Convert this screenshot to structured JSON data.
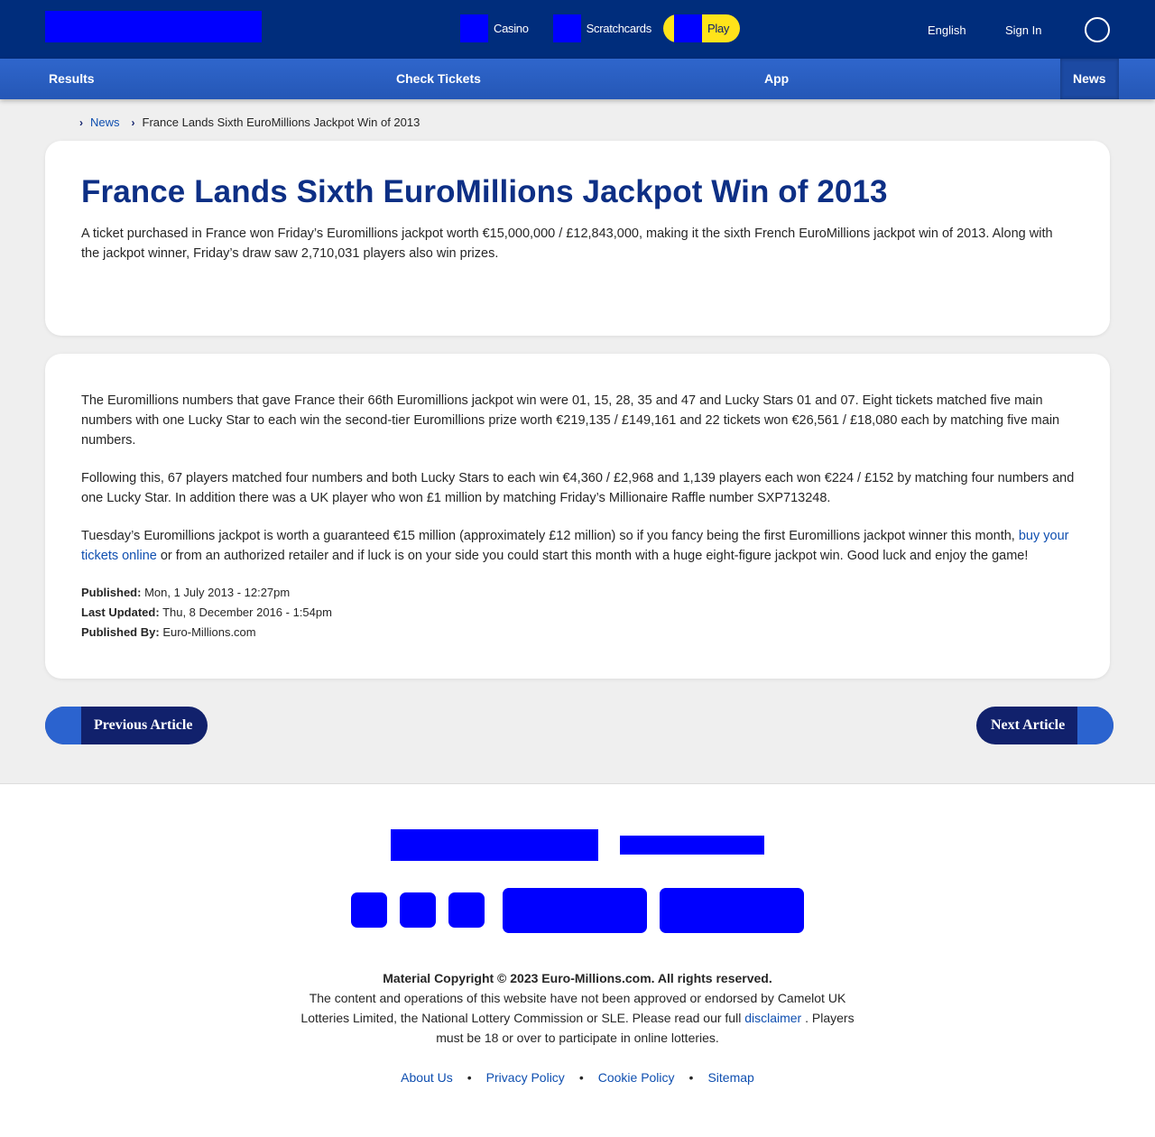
{
  "header": {
    "nav": [
      {
        "label": "Casino"
      },
      {
        "label": "Scratchcards"
      }
    ],
    "play_label": "Play",
    "language": "English",
    "sign_in": "Sign In"
  },
  "subnav": {
    "tabs": [
      "Results",
      "Check Tickets",
      "App",
      "News"
    ],
    "active": "News"
  },
  "breadcrumb": {
    "link": "News",
    "current": "France Lands Sixth EuroMillions Jackpot Win of 2013"
  },
  "article": {
    "title": "France Lands Sixth EuroMillions Jackpot Win of 2013",
    "intro": "A ticket purchased in France won Friday’s Euromillions jackpot worth €15,000,000 / £12,843,000, making it the sixth French EuroMillions jackpot win of 2013. Along with the jackpot winner, Friday’s draw saw 2,710,031 players also win prizes.",
    "p1": "The Euromillions numbers that gave France their 66th Euromillions jackpot win were 01, 15, 28, 35 and 47 and Lucky Stars 01 and 07. Eight tickets matched five main numbers with one Lucky Star to each win the second-tier Euromillions prize worth €219,135 / £149,161 and 22 tickets won €26,561 / £18,080 each by matching five main numbers.",
    "p2": "Following this, 67 players matched four numbers and both Lucky Stars to each win €4,360 / £2,968 and 1,139 players each won €224 / £152 by matching four numbers and one Lucky Star. In addition there was a UK player who won £1 million by matching Friday’s Millionaire Raffle number SXP713248.",
    "p3_before": "Tuesday’s Euromillions jackpot is worth a guaranteed €15 million (approximately £12 million) so if you fancy being the first Euromillions jackpot winner this month, ",
    "p3_link": "buy your tickets online",
    "p3_after": " or from an authorized retailer and if luck is on your side you could start this month with a huge eight-figure jackpot win. Good luck and enjoy the game!",
    "meta": {
      "published_label": "Published:",
      "published": "Mon, 1 July 2013 - 12:27pm",
      "updated_label": "Last Updated:",
      "updated": "Thu, 8 December 2016 - 1:54pm",
      "by_label": "Published By:",
      "by": "Euro-Millions.com"
    }
  },
  "pager": {
    "previous": "Previous Article",
    "next": "Next Article"
  },
  "footer": {
    "copyright_bold": "Material Copyright © 2023 Euro-Millions.com. All rights reserved.",
    "disclaimer_before": "The content and operations of this website have not been approved or endorsed by Camelot UK Lotteries Limited, the National Lottery Commission or SLE. Please read our full ",
    "disclaimer_link": "disclaimer",
    "disclaimer_after": " . Players must be 18 or over to participate in online lotteries.",
    "links": [
      "About Us",
      "Privacy Policy",
      "Cookie Policy",
      "Sitemap"
    ]
  },
  "colors": {
    "header_bg": "#002d7c",
    "subnav_bg": "#2f66cc",
    "accent_yellow": "#ffe31a",
    "title": "#0d2f85",
    "link": "#0f4fb0",
    "placeholder_block": "#0000ff"
  }
}
